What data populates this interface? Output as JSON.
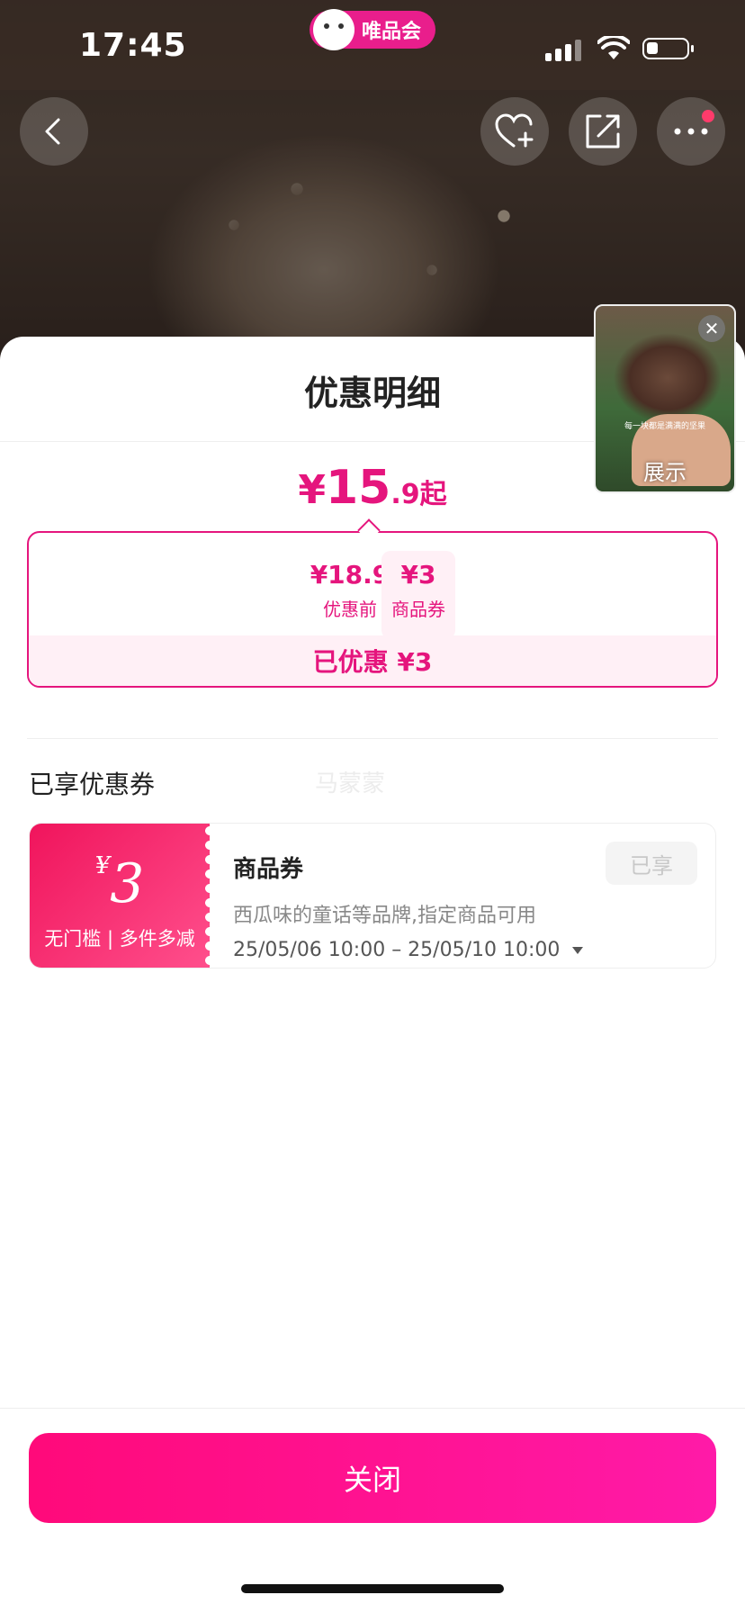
{
  "status_bar": {
    "time": "17:45",
    "brand": "唯品会"
  },
  "sheet": {
    "title": "优惠明细",
    "price": {
      "currency": "¥",
      "integer": "15",
      "decimal": ".9",
      "suffix": "起"
    },
    "breakdown": {
      "before_value": "¥18.9",
      "before_label": "优惠前",
      "minus": "-",
      "coupon_value": "¥3",
      "coupon_label": "商品券",
      "saved_text": "已优惠 ¥3"
    },
    "section_label": "已享优惠券",
    "watermark": "马蒙蒙",
    "coupon": {
      "currency": "¥",
      "amount": "3",
      "tag": "无门槛 | 多件多减",
      "name": "商品券",
      "description": "西瓜味的童话等品牌,指定商品可用",
      "validity": "25/05/06 10:00 – 25/05/10 10:00",
      "status": "已享"
    },
    "close_label": "关闭"
  },
  "pip": {
    "caption": "每一块都是满满的坚果",
    "label": "展示"
  },
  "icons": {
    "back": "chevron-left-icon",
    "favorite": "heart-plus-icon",
    "share": "share-icon",
    "more": "more-dots-icon",
    "close": "close-icon"
  },
  "colors": {
    "accent": "#e5157d",
    "button_start": "#ff0a7a",
    "button_end": "#ff1aa8",
    "coupon_start": "#f0145c",
    "coupon_end": "#ff4f8c"
  }
}
